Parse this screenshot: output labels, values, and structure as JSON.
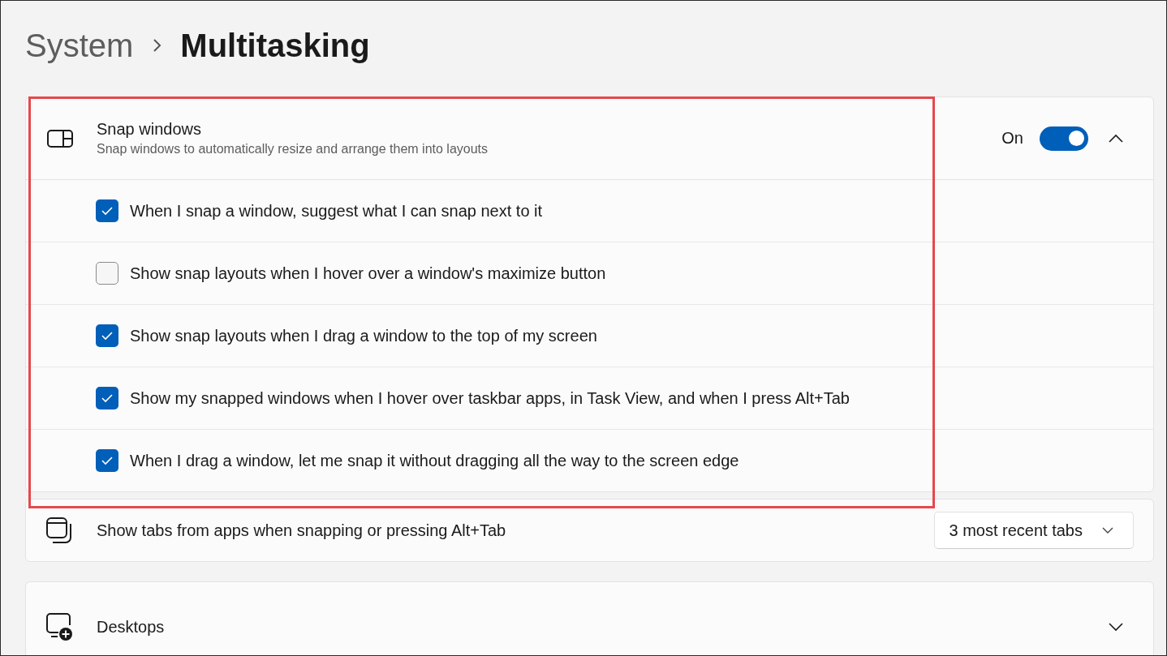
{
  "breadcrumb": {
    "parent": "System",
    "current": "Multitasking"
  },
  "snap_windows": {
    "title": "Snap windows",
    "description": "Snap windows to automatically resize and arrange them into layouts",
    "toggle_label": "On",
    "on": true,
    "expanded": true,
    "highlighted": true,
    "options": [
      {
        "label": "When I snap a window, suggest what I can snap next to it",
        "checked": true
      },
      {
        "label": "Show snap layouts when I hover over a window's maximize button",
        "checked": false
      },
      {
        "label": "Show snap layouts when I drag a window to the top of my screen",
        "checked": true
      },
      {
        "label": "Show my snapped windows when I hover over taskbar apps, in Task View, and when I press Alt+Tab",
        "checked": true
      },
      {
        "label": "When I drag a window, let me snap it without dragging all the way to the screen edge",
        "checked": true
      }
    ]
  },
  "tabs_setting": {
    "label": "Show tabs from apps when snapping or pressing Alt+Tab",
    "dropdown": {
      "value": "3 most recent tabs"
    }
  },
  "desktops": {
    "title": "Desktops",
    "expanded": false
  }
}
